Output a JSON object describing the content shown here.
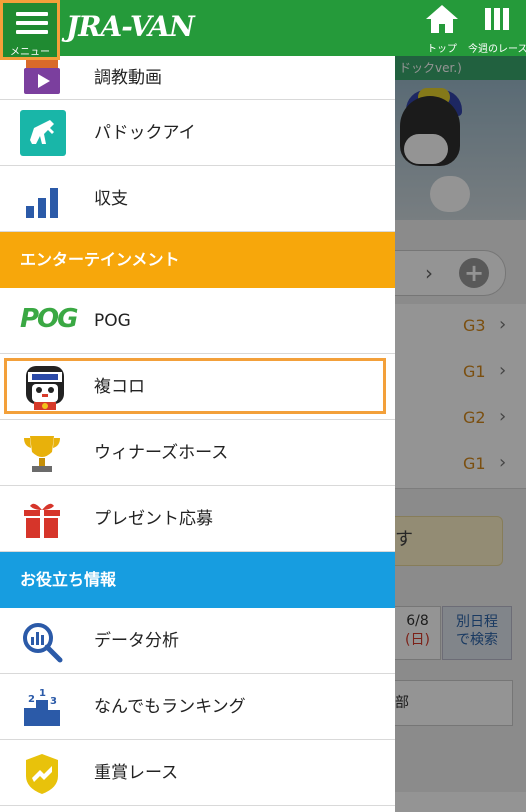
{
  "header": {
    "menu_label": "メニュー",
    "logo": "JRA-VAN",
    "top_label": "トップ",
    "week_label": "今週のレース"
  },
  "background": {
    "banner_text": "ドックver.)",
    "race_grades": [
      "G3",
      "G1",
      "G2",
      "G1"
    ],
    "notice_text": "す",
    "date_text": "6/8",
    "date_day": "(日)",
    "other_date_label_1": "別日程",
    "other_date_label_2": "で検索",
    "section_text": "部"
  },
  "drawer": {
    "items_top": [
      {
        "label": "調教動画",
        "icon": "training-video-icon"
      },
      {
        "label": "パドックアイ",
        "icon": "paddock-eye-icon"
      },
      {
        "label": "収支",
        "icon": "balance-chart-icon"
      }
    ],
    "section_entertainment": "エンターテインメント",
    "items_ent": [
      {
        "label": "POG",
        "icon": "pog-logo-icon"
      },
      {
        "label": "複コロ",
        "icon": "fukukoro-mascot-icon"
      },
      {
        "label": "ウィナーズホース",
        "icon": "trophy-icon"
      },
      {
        "label": "プレゼント応募",
        "icon": "gift-icon"
      }
    ],
    "section_help": "お役立ち情報",
    "items_help": [
      {
        "label": "データ分析",
        "icon": "data-analysis-icon"
      },
      {
        "label": "なんでもランキング",
        "icon": "ranking-podium-icon"
      },
      {
        "label": "重賞レース",
        "icon": "graded-race-icon"
      }
    ],
    "pog_icon_text": "POG"
  },
  "colors": {
    "header_green": "#259a3a",
    "entertainment_orange": "#f7a70b",
    "help_blue": "#179de0",
    "highlight_orange": "#f3a03a"
  }
}
